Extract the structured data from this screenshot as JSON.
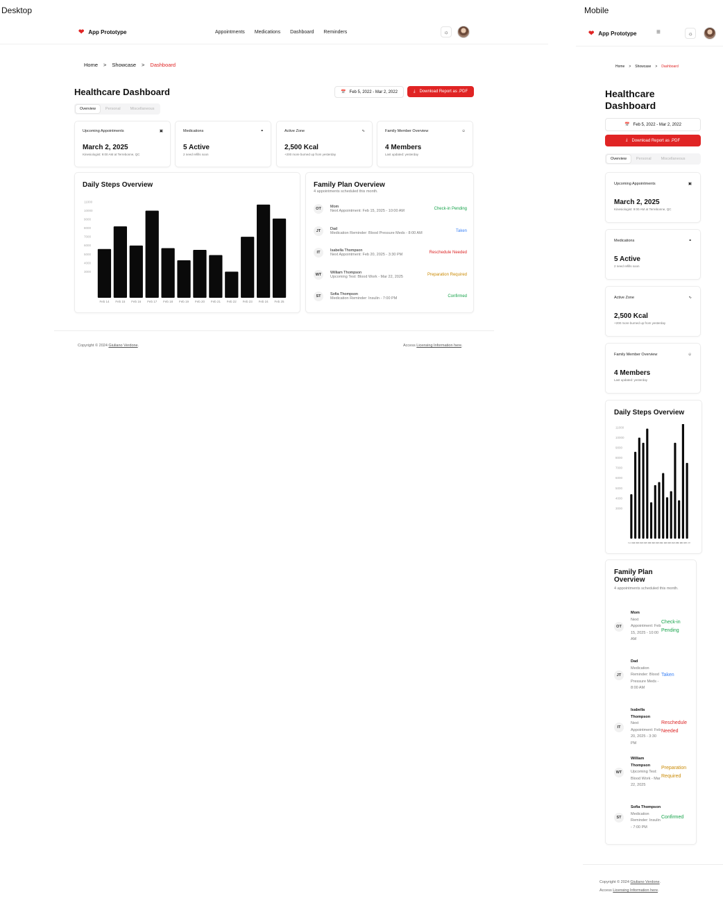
{
  "labels": {
    "desktop": "Desktop",
    "mobile": "Mobile"
  },
  "app": {
    "name": "App Prototype"
  },
  "nav": {
    "links": [
      "Appointments",
      "Medications",
      "Dashboard",
      "Reminders"
    ]
  },
  "breadcrumb": {
    "home": "Home",
    "sep": ">",
    "showcase": "Showcase",
    "current": "Dashboard"
  },
  "page": {
    "title": "Healthcare Dashboard",
    "date_range": "Feb 5, 2022 - Mar 2, 2022",
    "mobile_date_range": "Feb 5, 2022 - Mar 2, 2022",
    "download_label": "Download Report as .PDF"
  },
  "tabs": [
    "Overview",
    "Personal",
    "Miscellaneous"
  ],
  "stats": [
    {
      "title": "Upcoming Appointments",
      "icon": "calendar-icon",
      "value": "March 2, 2025",
      "sub": "Kinesiologist: 9:00 AM at Terrebonne, QC"
    },
    {
      "title": "Medications",
      "icon": "pill-icon",
      "value": "5 Active",
      "sub": "2 need refills soon"
    },
    {
      "title": "Active Zone",
      "icon": "activity-icon",
      "value": "2,500 Kcal",
      "sub": "+200 more burned up from yesterday"
    },
    {
      "title": "Family Member Overview",
      "icon": "users-icon",
      "value": "4 Members",
      "sub": "Last updated: yesterday"
    }
  ],
  "steps": {
    "title": "Daily Steps Overview"
  },
  "family": {
    "title": "Family Plan Overview",
    "subtitle": "4 appointments scheduled this month.",
    "members": [
      {
        "initials": "OT",
        "name": "Mom",
        "detail": "Next Appointment: Feb 15, 2025 - 10:00 AM",
        "status": "Check-in Pending",
        "color": "#16a34a"
      },
      {
        "initials": "JT",
        "name": "Dad",
        "detail": "Medication Reminder: Blood Pressure Meds - 8:00 AM",
        "status": "Taken",
        "color": "#3b82f6"
      },
      {
        "initials": "IT",
        "name": "Isabella Thompson",
        "detail": "Next Appointment: Feb 20, 2025 - 3:30 PM",
        "status": "Reschedule Needed",
        "color": "#dc2626"
      },
      {
        "initials": "WT",
        "name": "William Thompson",
        "detail": "Upcoming Test: Blood Work - Mar 22, 2025",
        "status": "Preparation Required",
        "color": "#ca8a04"
      },
      {
        "initials": "ST",
        "name": "Sofia Thompson",
        "detail": "Medication Reminder: Insulin - 7:00 PM",
        "status": "Confirmed",
        "color": "#16a34a"
      }
    ]
  },
  "footer": {
    "copyright_prefix": "Copyright © 2024 ",
    "author": "Giuliano Verdone",
    "copyright_suffix": ".",
    "access_prefix": "Access ",
    "access_link": "Licensing Information here",
    "access_suffix": "."
  },
  "chart_data": [
    {
      "type": "bar",
      "title": "Daily Steps Overview",
      "categories": [
        "Feb 14",
        "Feb 15",
        "Feb 16",
        "Feb 17",
        "Feb 18",
        "Feb 19",
        "Feb 20",
        "Feb 21",
        "Feb 22",
        "Feb 23",
        "Feb 24",
        "Feb 25"
      ],
      "values": [
        5600,
        8200,
        6000,
        10000,
        5700,
        4300,
        5500,
        4900,
        3000,
        7000,
        10700,
        9100
      ],
      "yticks": [
        3000,
        4000,
        5000,
        6000,
        7000,
        8000,
        9000,
        10000,
        11000
      ],
      "ylim": [
        0,
        11000
      ],
      "bar_color": "#0a0a0a"
    },
    {
      "type": "bar",
      "title": "Daily Steps Overview",
      "categories": [
        "Feb 14",
        "Feb 15",
        "Feb 16",
        "Feb 17",
        "Feb 18",
        "Feb 19",
        "Feb 20",
        "Feb 21",
        "Feb 22",
        "Feb 23",
        "Feb 24",
        "Feb 25",
        "Feb 26",
        "Feb 27",
        "Feb 28"
      ],
      "values": [
        4400,
        8600,
        10000,
        9500,
        10900,
        3600,
        5300,
        5600,
        6500,
        4100,
        4700,
        9500,
        3800,
        11400,
        7500
      ],
      "yticks": [
        3000,
        4000,
        5000,
        6000,
        7000,
        8000,
        9000,
        10000,
        11000
      ],
      "ylim": [
        0,
        11000
      ],
      "bar_color": "#0a0a0a"
    }
  ]
}
